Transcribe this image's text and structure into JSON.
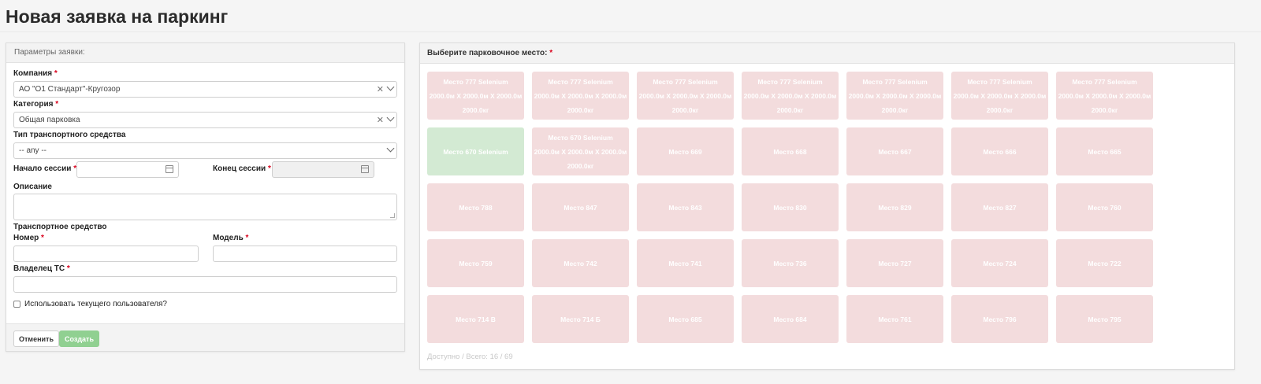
{
  "page": {
    "title": "Новая заявка на паркинг"
  },
  "form": {
    "header": "Параметры заявки:",
    "company": {
      "label": "Компания",
      "value": "АО \"О1 Стандарт\"-Кругозор"
    },
    "category": {
      "label": "Категория",
      "value": "Общая парковка"
    },
    "vehicle_type": {
      "label": "Тип транспортного средства",
      "value": "-- any --"
    },
    "session_start": {
      "label": "Начало сессии",
      "value": ""
    },
    "session_end": {
      "label": "Конец сессии",
      "value": ""
    },
    "description": {
      "label": "Описание",
      "value": ""
    },
    "vehicle_section": "Транспортное средство",
    "number": {
      "label": "Номер",
      "value": ""
    },
    "model": {
      "label": "Модель",
      "value": ""
    },
    "owner": {
      "label": "Владелец ТС",
      "value": ""
    },
    "use_current_user": {
      "label": "Использовать текущего пользователя?",
      "checked": false
    },
    "required_mark": "*",
    "cancel_label": "Отменить",
    "create_label": "Создать"
  },
  "parking": {
    "header": "Выберите парковочное место:",
    "required_mark": "*",
    "availability": "Доступно / Всего: 16 / 69",
    "colors": {
      "occupied": "#f3dcdd",
      "free": "#d3ead3"
    },
    "spots": [
      {
        "label": "Место 777 Selenium\n2000.0м X 2000.0м X 2000.0м\n2000.0кг",
        "free": false
      },
      {
        "label": "Место 777 Selenium\n2000.0м X 2000.0м X 2000.0м\n2000.0кг",
        "free": false
      },
      {
        "label": "Место 777 Selenium\n2000.0м X 2000.0м X 2000.0м\n2000.0кг",
        "free": false
      },
      {
        "label": "Место 777 Selenium\n2000.0м X 2000.0м X 2000.0м\n2000.0кг",
        "free": false
      },
      {
        "label": "Место 777 Selenium\n2000.0м X 2000.0м X 2000.0м\n2000.0кг",
        "free": false
      },
      {
        "label": "Место 777 Selenium\n2000.0м X 2000.0м X 2000.0м\n2000.0кг",
        "free": false
      },
      {
        "label": "Место 777 Selenium\n2000.0м X 2000.0м X 2000.0м\n2000.0кг",
        "free": false
      },
      {
        "label": "Место 670 Selenium",
        "free": true
      },
      {
        "label": "Место 670 Selenium\n2000.0м X 2000.0м X 2000.0м\n2000.0кг",
        "free": false
      },
      {
        "label": "Место 669",
        "free": false
      },
      {
        "label": "Место 668",
        "free": false
      },
      {
        "label": "Место 667",
        "free": false
      },
      {
        "label": "Место 666",
        "free": false
      },
      {
        "label": "Место 665",
        "free": false
      },
      {
        "label": "Место 788",
        "free": false
      },
      {
        "label": "Место 847",
        "free": false
      },
      {
        "label": "Место 843",
        "free": false
      },
      {
        "label": "Место 830",
        "free": false
      },
      {
        "label": "Место 829",
        "free": false
      },
      {
        "label": "Место 827",
        "free": false
      },
      {
        "label": "Место 760",
        "free": false
      },
      {
        "label": "Место 759",
        "free": false
      },
      {
        "label": "Место 742",
        "free": false
      },
      {
        "label": "Место 741",
        "free": false
      },
      {
        "label": "Место 736",
        "free": false
      },
      {
        "label": "Место 727",
        "free": false
      },
      {
        "label": "Место 724",
        "free": false
      },
      {
        "label": "Место 722",
        "free": false
      },
      {
        "label": "Место 714 В",
        "free": false
      },
      {
        "label": "Место 714 Б",
        "free": false
      },
      {
        "label": "Место 685",
        "free": false
      },
      {
        "label": "Место 684",
        "free": false
      },
      {
        "label": "Место 761",
        "free": false
      },
      {
        "label": "Место 796",
        "free": false
      },
      {
        "label": "Место 795",
        "free": false
      }
    ]
  }
}
